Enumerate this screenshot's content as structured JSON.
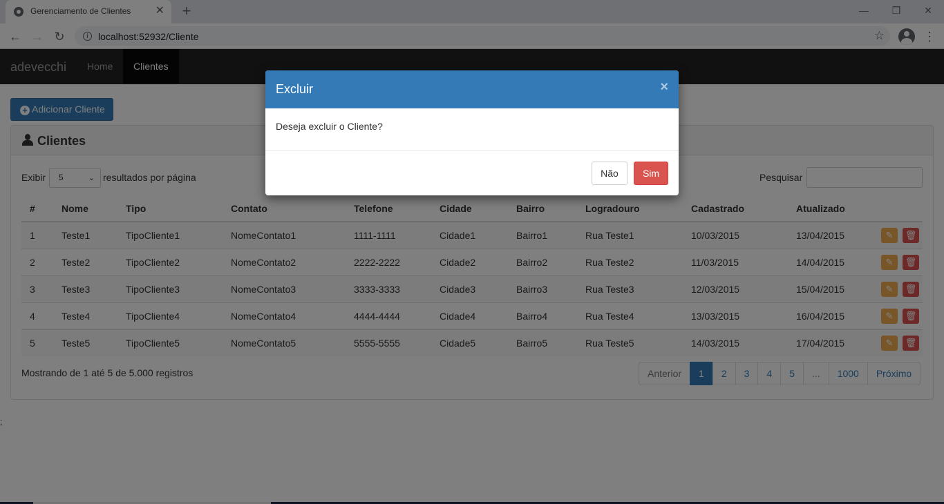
{
  "browser": {
    "tab_title": "Gerenciamento de Clientes",
    "tab_close": "✕",
    "new_tab": "+",
    "url": "localhost:52932/Cliente",
    "minimize": "—",
    "restore": "❐",
    "close": "✕",
    "back": "←",
    "forward": "→",
    "reload": "↻",
    "star": "☆",
    "menu": "⋮",
    "info": "i"
  },
  "navbar": {
    "brand": "adevecchi",
    "links": [
      {
        "label": "Home",
        "active": false
      },
      {
        "label": "Clientes",
        "active": true
      }
    ]
  },
  "page": {
    "add_button": "Adicionar Cliente",
    "add_icon": "+",
    "panel_title": "Clientes",
    "show_label": "Exibir",
    "page_size": "5",
    "select_caret": "⌄",
    "per_page_label": "resultados por página",
    "search_label": "Pesquisar",
    "search_value": "",
    "stray_text": ";",
    "table": {
      "columns": [
        "#",
        "Nome",
        "Tipo",
        "Contato",
        "Telefone",
        "Cidade",
        "Bairro",
        "Logradouro",
        "Cadastrado",
        "Atualizado",
        ""
      ],
      "rows": [
        [
          "1",
          "Teste1",
          "TipoCliente1",
          "NomeContato1",
          "1111-1111",
          "Cidade1",
          "Bairro1",
          "Rua Teste1",
          "10/03/2015",
          "13/04/2015"
        ],
        [
          "2",
          "Teste2",
          "TipoCliente2",
          "NomeContato2",
          "2222-2222",
          "Cidade2",
          "Bairro2",
          "Rua Teste2",
          "11/03/2015",
          "14/04/2015"
        ],
        [
          "3",
          "Teste3",
          "TipoCliente3",
          "NomeContato3",
          "3333-3333",
          "Cidade3",
          "Bairro3",
          "Rua Teste3",
          "12/03/2015",
          "15/04/2015"
        ],
        [
          "4",
          "Teste4",
          "TipoCliente4",
          "NomeContato4",
          "4444-4444",
          "Cidade4",
          "Bairro4",
          "Rua Teste4",
          "13/03/2015",
          "16/04/2015"
        ],
        [
          "5",
          "Teste5",
          "TipoCliente5",
          "NomeContato5",
          "5555-5555",
          "Cidade5",
          "Bairro5",
          "Rua Teste5",
          "14/03/2015",
          "17/04/2015"
        ]
      ],
      "edit_icon": "✎",
      "delete_icon": "🗑"
    },
    "info_text": "Mostrando de 1 até 5 de 5.000 registros",
    "pagination": [
      {
        "label": "Anterior",
        "state": "disabled"
      },
      {
        "label": "1",
        "state": "active"
      },
      {
        "label": "2",
        "state": ""
      },
      {
        "label": "3",
        "state": ""
      },
      {
        "label": "4",
        "state": ""
      },
      {
        "label": "5",
        "state": ""
      },
      {
        "label": "...",
        "state": "disabled"
      },
      {
        "label": "1000",
        "state": ""
      },
      {
        "label": "Próximo",
        "state": ""
      }
    ]
  },
  "modal": {
    "title": "Excluir",
    "close": "×",
    "body": "Deseja excluir o Cliente?",
    "no_button": "Não",
    "yes_button": "Sim"
  },
  "colors": {
    "primary": "#337ab7",
    "danger": "#d9534f",
    "warning": "#f0ad4e",
    "navbar": "#222222"
  }
}
